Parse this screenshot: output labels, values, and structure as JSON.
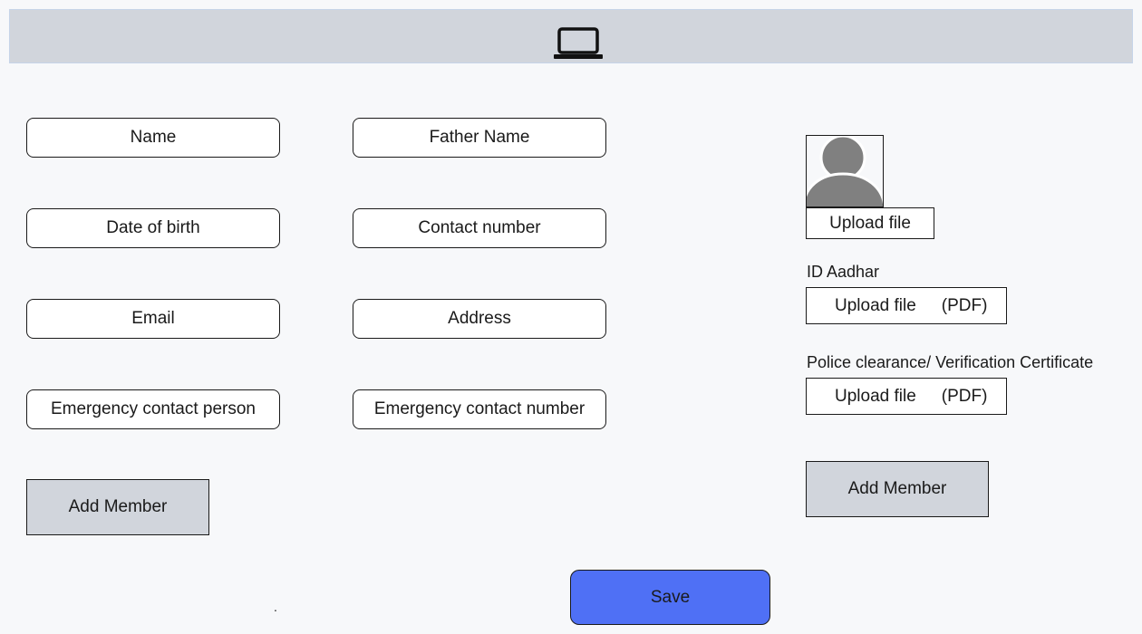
{
  "header": {
    "icon": "laptop-icon"
  },
  "form": {
    "name": "Name",
    "father_name": "Father Name",
    "dob": "Date of birth",
    "contact_number": "Contact number",
    "email": "Email",
    "address": "Address",
    "emergency_person": "Emergency contact person",
    "emergency_number": "Emergency contact number",
    "add_member": "Add Member"
  },
  "uploads": {
    "photo": {
      "button": "Upload file",
      "icon": "user-avatar-icon"
    },
    "id": {
      "label": "ID Aadhar",
      "button": "Upload file",
      "format": "(PDF)"
    },
    "police": {
      "label": "Police clearance/ Verification Certificate",
      "button": "Upload file",
      "format": "(PDF)"
    },
    "add_member": "Add Member"
  },
  "actions": {
    "save": "Save",
    "save_color": "#4f70f5"
  },
  "footer": {
    "dot": "."
  }
}
